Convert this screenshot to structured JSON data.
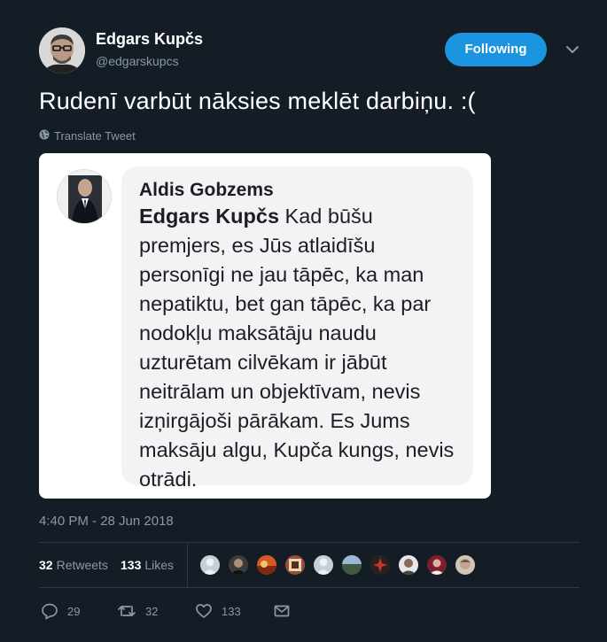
{
  "author": {
    "name": "Edgars Kupčs",
    "handle": "@edgarskupcs"
  },
  "follow_button": {
    "label": "Following"
  },
  "tweet": {
    "text": "Rudenī varbūt nāksies meklēt darbiņu. :(",
    "translate_label": "Translate Tweet",
    "timestamp": "4:40 PM - 28 Jun 2018"
  },
  "embedded_comment": {
    "author": "Aldis Gobzems",
    "tag": "Edgars Kupčs",
    "body": " Kad būšu premjers, es Jūs atlaidīšu personīgi ne jau tāpēc, ka man nepatiktu, bet gan tāpēc, ka par nodokļu maksātāju naudu uzturētam cilvēkam ir jābūt neitrālam un objektīvam, nevis izņirgājoši pārākam. Es Jums maksāju algu, Kupča kungs, nevis otrādi."
  },
  "stats": {
    "retweets_count": "32",
    "retweets_label": "Retweets",
    "likes_count": "133",
    "likes_label": "Likes"
  },
  "actions": {
    "reply_count": "29",
    "retweet_count": "32",
    "like_count": "133"
  },
  "colors": {
    "background": "#141d26",
    "accent": "#1b95e0",
    "muted": "#8899a6"
  }
}
